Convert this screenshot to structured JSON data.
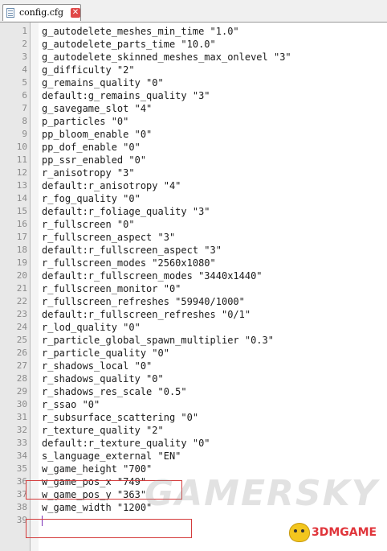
{
  "tab": {
    "label": "config.cfg",
    "close_glyph": "✕"
  },
  "lines": [
    {
      "n": "1",
      "text": "g_autodelete_meshes_min_time \"1.0\""
    },
    {
      "n": "2",
      "text": "g_autodelete_parts_time \"10.0\""
    },
    {
      "n": "3",
      "text": "g_autodelete_skinned_meshes_max_onlevel \"3\""
    },
    {
      "n": "4",
      "text": "g_difficulty \"2\""
    },
    {
      "n": "5",
      "text": "g_remains_quality \"0\""
    },
    {
      "n": "6",
      "text": "default:g_remains_quality \"3\""
    },
    {
      "n": "7",
      "text": "g_savegame_slot \"4\""
    },
    {
      "n": "8",
      "text": "p_particles \"0\""
    },
    {
      "n": "9",
      "text": "pp_bloom_enable \"0\""
    },
    {
      "n": "10",
      "text": "pp_dof_enable \"0\""
    },
    {
      "n": "11",
      "text": "pp_ssr_enabled \"0\""
    },
    {
      "n": "12",
      "text": "r_anisotropy \"3\""
    },
    {
      "n": "13",
      "text": "default:r_anisotropy \"4\""
    },
    {
      "n": "14",
      "text": "r_fog_quality \"0\""
    },
    {
      "n": "15",
      "text": "default:r_foliage_quality \"3\""
    },
    {
      "n": "16",
      "text": "r_fullscreen \"0\""
    },
    {
      "n": "17",
      "text": "r_fullscreen_aspect \"3\""
    },
    {
      "n": "18",
      "text": "default:r_fullscreen_aspect \"3\""
    },
    {
      "n": "19",
      "text": "r_fullscreen_modes \"2560x1080\""
    },
    {
      "n": "20",
      "text": "default:r_fullscreen_modes \"3440x1440\""
    },
    {
      "n": "21",
      "text": "r_fullscreen_monitor \"0\""
    },
    {
      "n": "22",
      "text": "r_fullscreen_refreshes \"59940/1000\""
    },
    {
      "n": "23",
      "text": "default:r_fullscreen_refreshes \"0/1\""
    },
    {
      "n": "24",
      "text": "r_lod_quality \"0\""
    },
    {
      "n": "25",
      "text": "r_particle_global_spawn_multiplier \"0.3\""
    },
    {
      "n": "26",
      "text": "r_particle_quality \"0\""
    },
    {
      "n": "27",
      "text": "r_shadows_local \"0\""
    },
    {
      "n": "28",
      "text": "r_shadows_quality \"0\""
    },
    {
      "n": "29",
      "text": "r_shadows_res_scale \"0.5\""
    },
    {
      "n": "30",
      "text": "r_ssao \"0\""
    },
    {
      "n": "31",
      "text": "r_subsurface_scattering \"0\""
    },
    {
      "n": "32",
      "text": "r_texture_quality \"2\""
    },
    {
      "n": "33",
      "text": "default:r_texture_quality \"0\""
    },
    {
      "n": "34",
      "text": "s_language_external \"EN\""
    },
    {
      "n": "35",
      "text": "w_game_height \"700\""
    },
    {
      "n": "36",
      "text": "w_game_pos_x \"749\""
    },
    {
      "n": "37",
      "text": "w_game_pos_y \"363\""
    },
    {
      "n": "38",
      "text": "w_game_width \"1200\""
    },
    {
      "n": "39",
      "text": ""
    }
  ],
  "highlight_color": "#d43c3c",
  "watermark": "GAMERSKY",
  "logo": {
    "text": "3DMGAME",
    "mascot_icon": "mascot-icon"
  },
  "caret_color": "#7a2fb5"
}
